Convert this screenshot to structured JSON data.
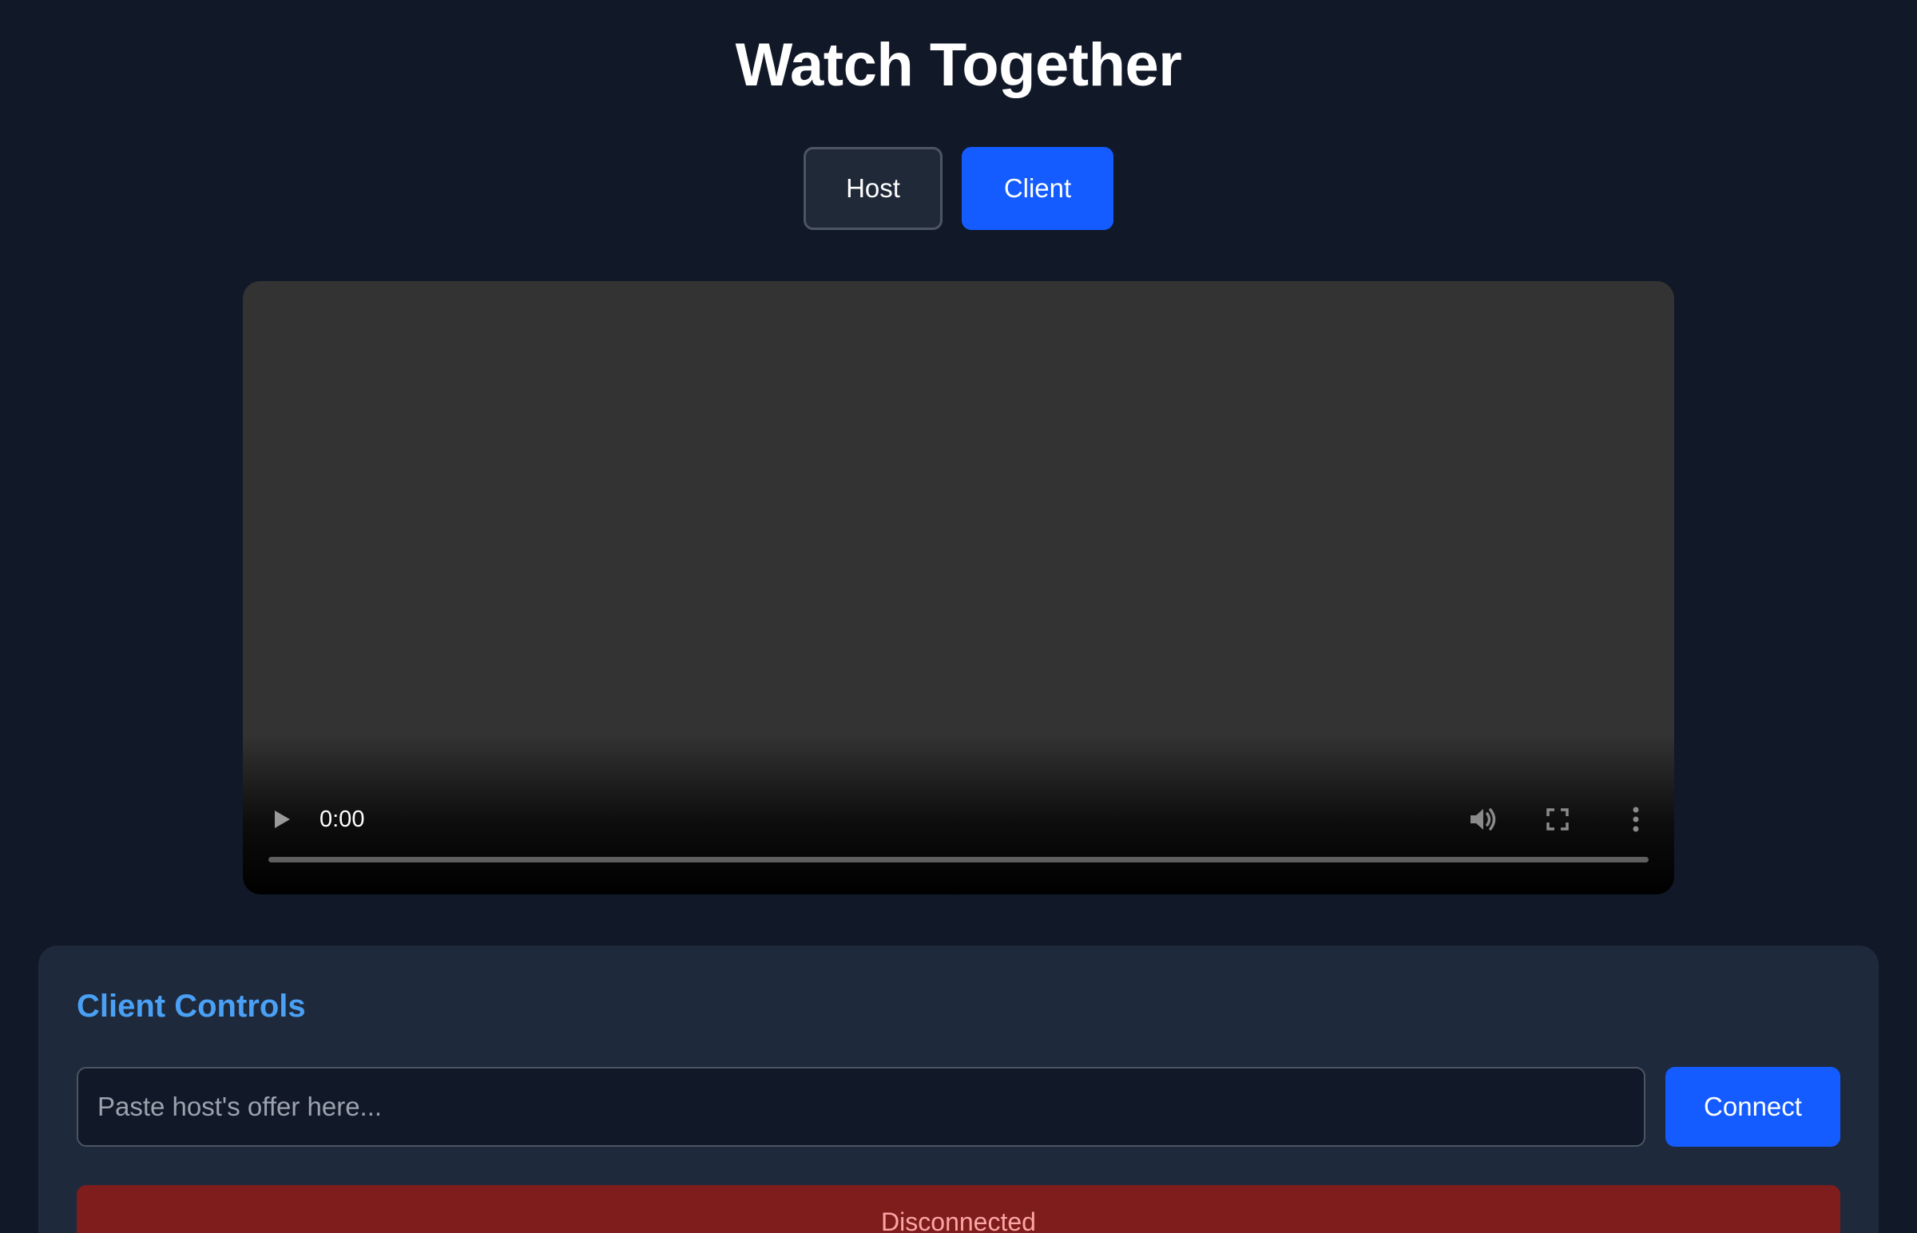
{
  "app": {
    "title": "Watch Together"
  },
  "mode_toggle": {
    "host_label": "Host",
    "client_label": "Client",
    "active": "Client"
  },
  "video_player": {
    "current_time": "0:00",
    "progress": 0,
    "controls": [
      "play-icon",
      "volume-icon",
      "fullscreen-icon",
      "more-options-icon"
    ]
  },
  "client_controls": {
    "heading": "Client Controls",
    "offer_input": {
      "placeholder": "Paste host's offer here...",
      "value": ""
    },
    "connect_label": "Connect",
    "status": "Disconnected"
  },
  "colors": {
    "background": "#111827",
    "panel": "#1e293b",
    "accent": "#145cff",
    "heading_accent": "#4aa0f5",
    "status_bg": "#7f1d1d",
    "status_text": "#fca5a5"
  }
}
